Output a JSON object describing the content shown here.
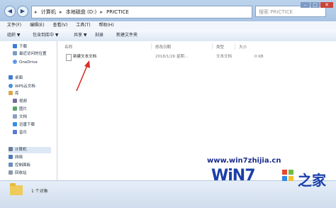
{
  "window": {
    "back_arrow": "◀",
    "forward_arrow": "▶",
    "address_crumbs": [
      "▸",
      "计算机",
      "▸",
      "本地磁盘 (D:)",
      "▸",
      "PRICTICE"
    ],
    "search_placeholder": "搜索 PRICTICE",
    "min": "–",
    "max": "□",
    "close": "✕"
  },
  "menu": {
    "items": [
      "文件(F)",
      "编辑(E)",
      "查看(V)",
      "工具(T)",
      "帮助(H)"
    ]
  },
  "toolbar": {
    "items": [
      "组织 ▼",
      "包含到库中 ▼",
      "共享 ▼",
      "刻录",
      "新建文件夹"
    ]
  },
  "sidebar": {
    "items": [
      {
        "label": "下载",
        "color": "#3a7bd5"
      },
      {
        "label": "最近访问的位置",
        "color": "#7c9bc4"
      },
      {
        "label": "OneDrive",
        "color": "#5a9be8"
      },
      {
        "label": "桌面",
        "color": "#3f7fcf"
      },
      {
        "label": "WPS云文档",
        "color": "#4a90d9"
      },
      {
        "label": "库",
        "color": "#d8a84a"
      },
      {
        "label": "视频",
        "color": "#7a6a9a"
      },
      {
        "label": "图片",
        "color": "#5aa36a"
      },
      {
        "label": "文档",
        "color": "#8aa0c0"
      },
      {
        "label": "迅雷下载",
        "color": "#3a8ee0"
      },
      {
        "label": "音乐",
        "color": "#5a7ad0"
      },
      {
        "label": "计算机",
        "color": "#6b7d95"
      },
      {
        "label": "网络",
        "color": "#4d79b8"
      },
      {
        "label": "控制面板",
        "color": "#6a8cc0"
      },
      {
        "label": "回收站",
        "color": "#8a9aa8"
      }
    ]
  },
  "columns": [
    "名称",
    "修改日期",
    "类型",
    "大小"
  ],
  "files": [
    {
      "name": "新建文本文档",
      "date": "2018/1/26 星期...",
      "type": "文本文档",
      "size": "0 KB"
    }
  ],
  "status": {
    "text": "1 个对象"
  },
  "watermark": {
    "url": "www.win7zhijia.cn",
    "brand": "WiN7",
    "home": "之家"
  }
}
